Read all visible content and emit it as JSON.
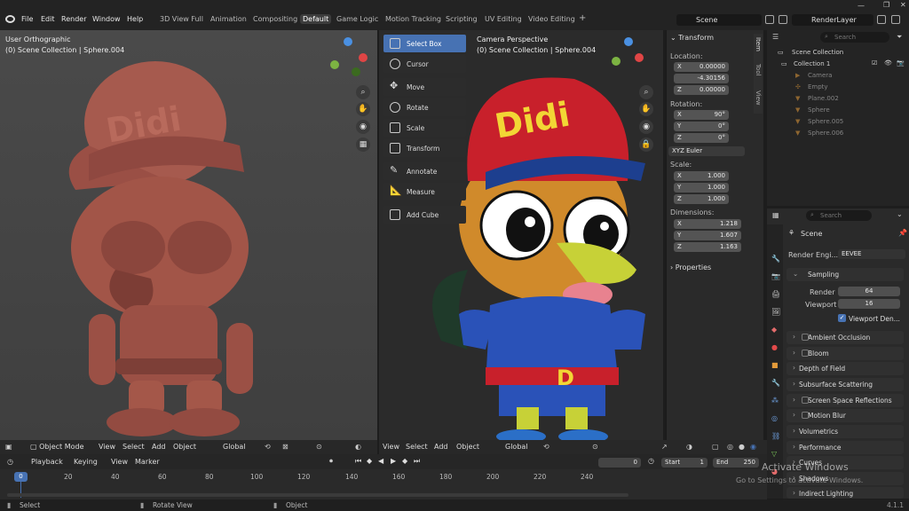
{
  "menubar": {
    "items": [
      "File",
      "Edit",
      "Render",
      "Window",
      "Help"
    ],
    "workspaces": [
      "3D View Full",
      "Animation",
      "Compositing",
      "Default",
      "Game Logic",
      "Motion Tracking",
      "Scripting",
      "UV Editing",
      "Video Editing"
    ],
    "active_workspace": "Default",
    "add_tab": "+",
    "scene": "Scene",
    "view_layer": "RenderLayer"
  },
  "left_viewport": {
    "title": "User Orthographic",
    "subtitle": "(0) Scene Collection | Sphere.004",
    "model_color": "#a0524a",
    "header": {
      "mode": "Object Mode",
      "view": "View",
      "select": "Select",
      "add": "Add",
      "object": "Object",
      "orientation": "Global"
    }
  },
  "right_viewport": {
    "title": "Camera Perspective",
    "subtitle": "(0) Scene Collection | Sphere.004",
    "header": {
      "view": "View",
      "select": "Select",
      "add": "Add",
      "object": "Object",
      "orientation": "Global"
    }
  },
  "toolbar": {
    "tools": [
      "Select Box",
      "Cursor",
      "Move",
      "Rotate",
      "Scale",
      "Transform",
      "Annotate",
      "Measure",
      "Add Cube"
    ],
    "active": "Select Box"
  },
  "transform_panel": {
    "header": "Transform",
    "location_label": "Location:",
    "location": [
      {
        "axis": "X",
        "value": "0.00000"
      },
      {
        "axis": "",
        "value": "-4.30156"
      },
      {
        "axis": "Z",
        "value": "0.00000"
      }
    ],
    "rotation_label": "Rotation:",
    "rotation": [
      {
        "axis": "X",
        "value": "90°"
      },
      {
        "axis": "Y",
        "value": "0°"
      },
      {
        "axis": "Z",
        "value": "0°"
      }
    ],
    "rotation_mode": "XYZ Euler",
    "scale_label": "Scale:",
    "scale": [
      {
        "axis": "X",
        "value": "1.000"
      },
      {
        "axis": "Y",
        "value": "1.000"
      },
      {
        "axis": "Z",
        "value": "1.000"
      }
    ],
    "dimensions_label": "Dimensions:",
    "dimensions": [
      {
        "axis": "X",
        "value": "1.218"
      },
      {
        "axis": "Y",
        "value": "1.607"
      },
      {
        "axis": "Z",
        "value": "1.163"
      }
    ],
    "properties": "Properties",
    "side_tabs": [
      "Item",
      "Tool",
      "View"
    ]
  },
  "outliner": {
    "search_placeholder": "Search",
    "rows": [
      {
        "name": "Scene Collection",
        "indent": 0,
        "type": "scene"
      },
      {
        "name": "Collection 1",
        "indent": 1,
        "type": "collection"
      },
      {
        "name": "Camera",
        "indent": 2,
        "type": "camera"
      },
      {
        "name": "Empty",
        "indent": 2,
        "type": "empty"
      },
      {
        "name": "Plane.002",
        "indent": 2,
        "type": "mesh"
      },
      {
        "name": "Sphere",
        "indent": 2,
        "type": "mesh"
      },
      {
        "name": "Sphere.005",
        "indent": 2,
        "type": "mesh"
      },
      {
        "name": "Sphere.006",
        "indent": 2,
        "type": "mesh"
      }
    ]
  },
  "properties": {
    "search_placeholder": "Search",
    "scene": "Scene",
    "render_engine_label": "Render Engi...",
    "render_engine": "EEVEE",
    "sampling": "Sampling",
    "render_label": "Render",
    "render_value": "64",
    "viewport_label": "Viewport",
    "viewport_value": "16",
    "viewport_denoise": "Viewport Den...",
    "sections": [
      "Ambient Occlusion",
      "Bloom",
      "Depth of Field",
      "Subsurface Scattering",
      "Screen Space Reflections",
      "Motion Blur",
      "Volumetrics",
      "Performance",
      "Curves",
      "Shadows",
      "Indirect Lighting"
    ]
  },
  "timeline": {
    "playback": "Playback",
    "keying": "Keying",
    "view": "View",
    "marker": "Marker",
    "current_frame": "0",
    "start_label": "Start",
    "start": "1",
    "end_label": "End",
    "end": "250",
    "playhead": "0",
    "ticks": [
      "20",
      "40",
      "60",
      "80",
      "100",
      "120",
      "140",
      "160",
      "180",
      "200",
      "220",
      "240"
    ]
  },
  "statusbar": {
    "select": "Select",
    "rotate": "Rotate View",
    "object": "Object",
    "version": "4.1.1"
  },
  "watermark": {
    "line1": "Activate Windows",
    "line2": "Go to Settings to activate Windows."
  },
  "colors": {
    "accent": "#4772b3",
    "header": "#232323",
    "panel": "#2a2a2a"
  }
}
